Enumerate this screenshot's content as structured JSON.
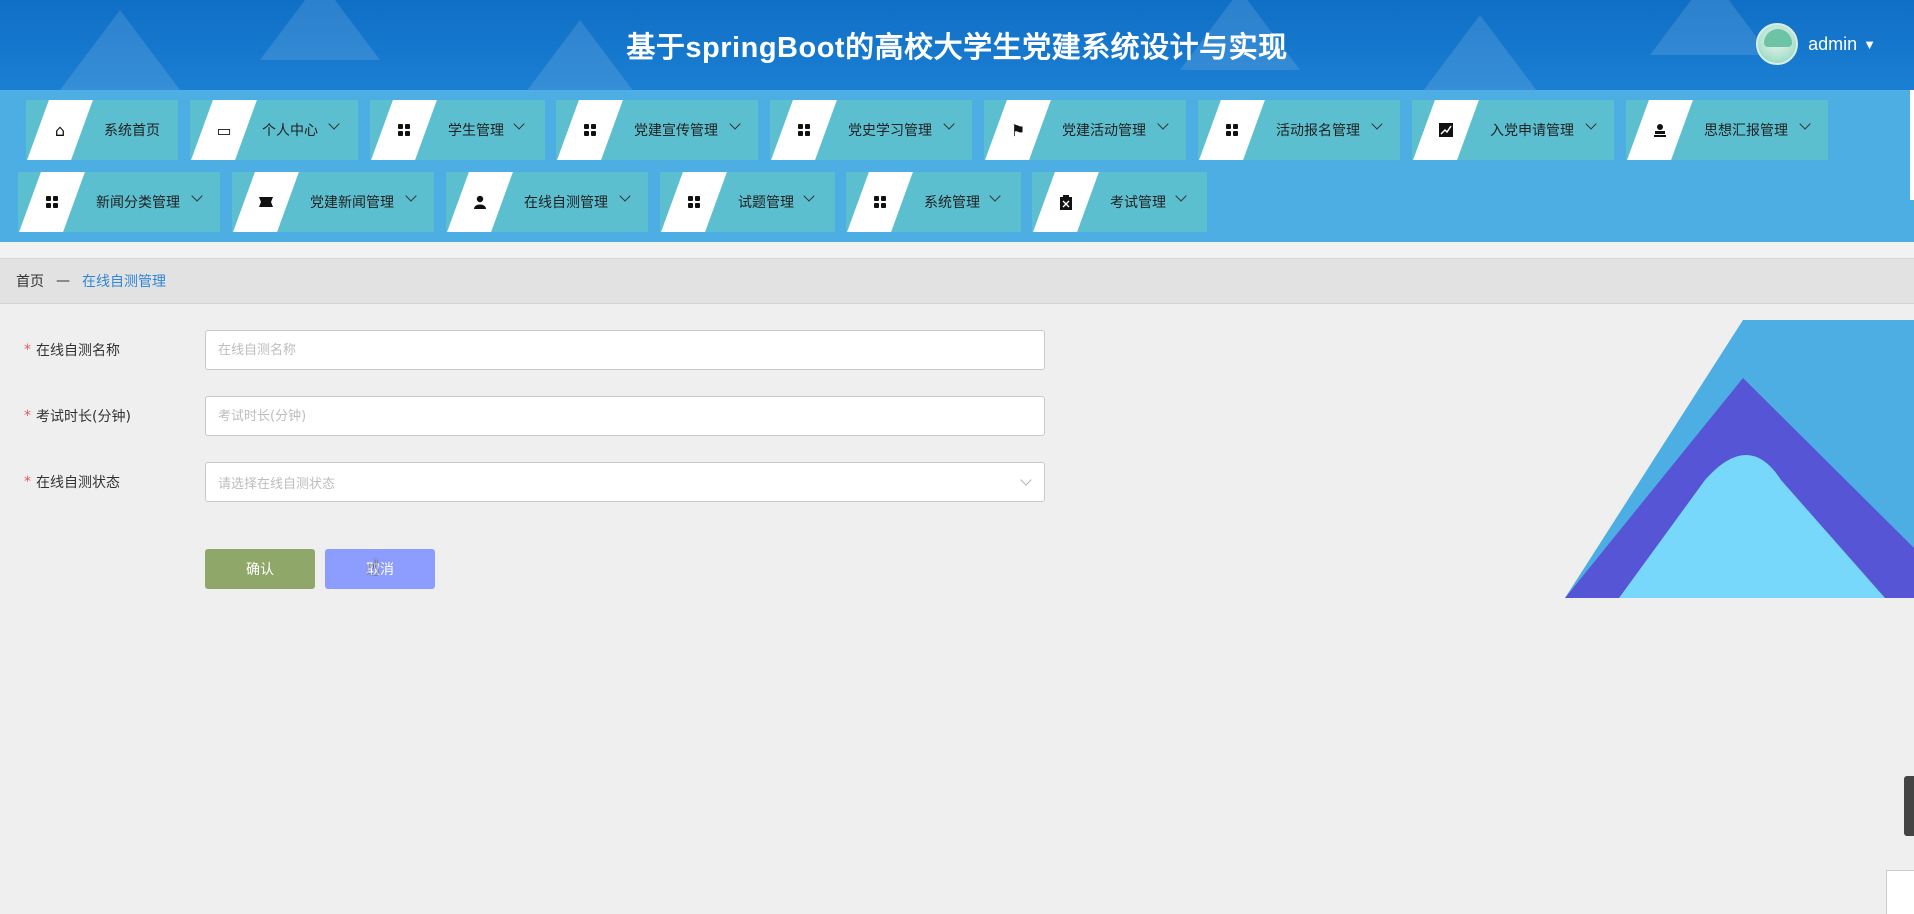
{
  "header": {
    "title": "基于springBoot的高校大学生党建系统设计与实现",
    "username": "admin",
    "caret": "▼"
  },
  "nav": {
    "items": [
      {
        "label": "系统首页",
        "icon": "home-icon",
        "glyph": "⌂",
        "has_dropdown": false
      },
      {
        "label": "个人中心",
        "icon": "wallet-icon",
        "glyph": "▭",
        "has_dropdown": true
      },
      {
        "label": "学生管理",
        "icon": "grid-icon",
        "has_dropdown": true
      },
      {
        "label": "党建宣传管理",
        "icon": "grid-icon",
        "has_dropdown": true
      },
      {
        "label": "党史学习管理",
        "icon": "grid-icon",
        "has_dropdown": true
      },
      {
        "label": "党建活动管理",
        "icon": "flag-icon",
        "glyph": "⚑",
        "has_dropdown": true
      },
      {
        "label": "活动报名管理",
        "icon": "grid-icon",
        "has_dropdown": true
      },
      {
        "label": "入党申请管理",
        "icon": "chart-icon",
        "glyph": "📈",
        "has_dropdown": true
      },
      {
        "label": "思想汇报管理",
        "icon": "stamp-icon",
        "glyph": "⍝",
        "has_dropdown": true
      },
      {
        "label": "新闻分类管理",
        "icon": "grid-icon",
        "has_dropdown": true
      },
      {
        "label": "党建新闻管理",
        "icon": "ticket-icon",
        "glyph": "✂",
        "has_dropdown": true
      },
      {
        "label": "在线自测管理",
        "icon": "user-icon",
        "glyph": "👤",
        "has_dropdown": true
      },
      {
        "label": "试题管理",
        "icon": "grid-icon",
        "has_dropdown": true
      },
      {
        "label": "系统管理",
        "icon": "grid-icon",
        "has_dropdown": true
      },
      {
        "label": "考试管理",
        "icon": "clipboard-icon",
        "glyph": "☒",
        "has_dropdown": true
      }
    ]
  },
  "breadcrumb": {
    "home": "首页",
    "separator": "—",
    "current": "在线自测管理"
  },
  "form": {
    "name": {
      "label": "在线自测名称",
      "placeholder": "在线自测名称",
      "value": ""
    },
    "duration": {
      "label": "考试时长(分钟)",
      "placeholder": "考试时长(分钟)",
      "value": ""
    },
    "status": {
      "label": "在线自测状态",
      "placeholder": "请选择在线自测状态"
    },
    "required_mark": "*",
    "confirm_label": "确认",
    "cancel_label": "取消"
  },
  "colors": {
    "header_bg": "#1b7fd2",
    "nav_bg": "#4caee2",
    "nav_item_bg": "#5bbfcf",
    "confirm_bg": "#8fa86a",
    "cancel_bg": "#8c9cff",
    "breadcrumb_active": "#2f86d6"
  }
}
